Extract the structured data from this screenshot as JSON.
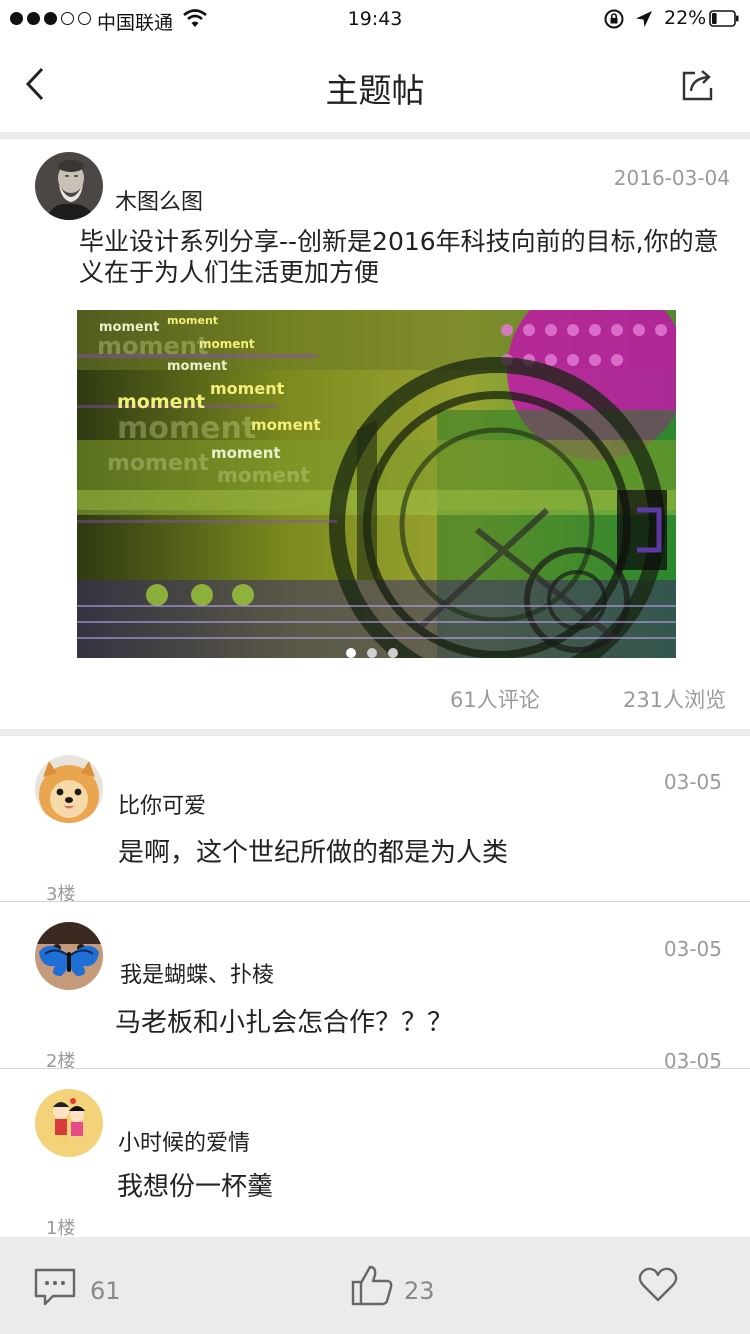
{
  "status_bar": {
    "carrier": "中国联通",
    "time": "19:43",
    "battery": "22%",
    "signal_bars": 3,
    "signal_total": 5,
    "battery_level": 0.22
  },
  "nav": {
    "title": "主题帖",
    "back_icon": "chevron-left-icon",
    "share_icon": "share-icon"
  },
  "post": {
    "author": "木图么图",
    "date": "2016-03-04",
    "title": "毕业设计系列分享--创新是2016年科技向前的目标,你的意义在于为人们生活更加方便",
    "image_words": [
      "moment",
      "moment",
      "moment",
      "moment",
      "moment",
      "moment",
      "moment",
      "moment"
    ],
    "image_pages": 3,
    "image_active_page": 1,
    "comments": "61人评论",
    "views": "231人浏览"
  },
  "comments": [
    {
      "author": "比你可爱",
      "text": "是啊，这个世纪所做的都是为人类",
      "date": "03-05",
      "floor": "3楼"
    },
    {
      "author": "我是蝴蝶、扑棱",
      "text": "马老板和小扎会怎合作？？？",
      "date": "03-05",
      "floor": "2楼"
    },
    {
      "author": "小时候的爱情",
      "text": "我想份一杯羹",
      "date": "03-05",
      "floor": "1楼"
    }
  ],
  "toolbar": {
    "comment_count": "61",
    "like_count": "23",
    "icons": [
      "comment-icon",
      "thumbs-up-icon",
      "heart-icon"
    ]
  },
  "colors": {
    "muted_text": "#9a9a9a",
    "divider": "#ececec",
    "toolbar_bg": "#ebebeb"
  }
}
